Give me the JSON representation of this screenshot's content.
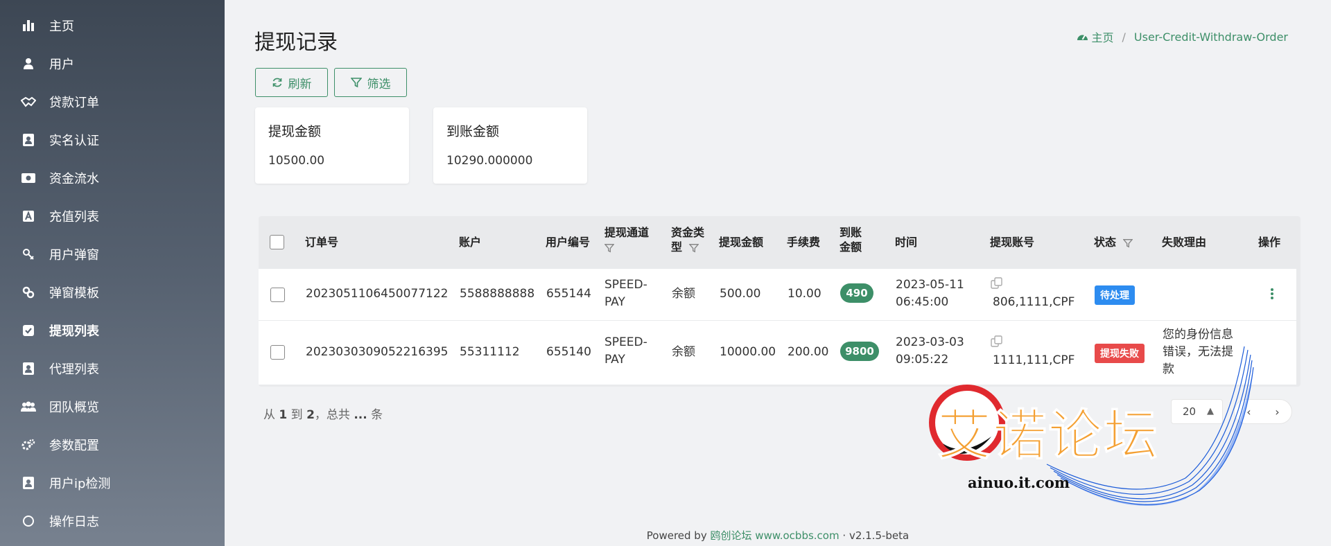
{
  "sidebar": {
    "items": [
      {
        "label": "主页",
        "icon": "bar-chart-icon"
      },
      {
        "label": "用户",
        "icon": "user-icon"
      },
      {
        "label": "贷款订单",
        "icon": "handshake-icon"
      },
      {
        "label": "实名认证",
        "icon": "id-card-icon"
      },
      {
        "label": "资金流水",
        "icon": "money-icon"
      },
      {
        "label": "充值列表",
        "icon": "recharge-icon"
      },
      {
        "label": "用户弹窗",
        "icon": "popup-icon"
      },
      {
        "label": "弹窗模板",
        "icon": "link-icon"
      },
      {
        "label": "提现列表",
        "icon": "check-square-icon",
        "active": true
      },
      {
        "label": "代理列表",
        "icon": "agent-icon"
      },
      {
        "label": "团队概览",
        "icon": "team-icon"
      },
      {
        "label": "参数配置",
        "icon": "cogs-icon"
      },
      {
        "label": "用户ip检测",
        "icon": "ip-check-icon"
      },
      {
        "label": "操作日志",
        "icon": "circle-icon"
      }
    ]
  },
  "header": {
    "title": "提现记录",
    "breadcrumb": {
      "home": "主页",
      "separator": "/",
      "current": "User-Credit-Withdraw-Order"
    }
  },
  "toolbar": {
    "refresh_label": "刷新",
    "filter_label": "筛选"
  },
  "stats": [
    {
      "title": "提现金额",
      "value": "10500.00"
    },
    {
      "title": "到账金额",
      "value": "10290.000000"
    }
  ],
  "table": {
    "columns": {
      "order_no": "订单号",
      "account": "账户",
      "user_id": "用户编号",
      "channel": "提现通道",
      "fund_type": "资金类型",
      "amount": "提现金额",
      "fee": "手续费",
      "received": "到账金额",
      "time": "时间",
      "withdraw_account": "提现账号",
      "status": "状态",
      "fail_reason": "失败理由",
      "actions": "操作"
    },
    "rows": [
      {
        "order_no": "2023051106450077122",
        "account": "5588888888",
        "user_id": "655144",
        "channel": "SPEED-PAY",
        "fund_type": "余额",
        "amount": "500.00",
        "fee": "10.00",
        "received": "490",
        "time": "2023-05-11 06:45:00",
        "withdraw_account": "806,1111,CPF",
        "status": "待处理",
        "status_color": "#2d8cf0",
        "fail_reason": ""
      },
      {
        "order_no": "2023030309052216395",
        "account": "55311112",
        "user_id": "655140",
        "channel": "SPEED-PAY",
        "fund_type": "余额",
        "amount": "10000.00",
        "fee": "200.00",
        "received": "9800",
        "time": "2023-03-03 09:05:22",
        "withdraw_account": "1111,111,CPF",
        "status": "提现失败",
        "status_color": "#e84a4a",
        "fail_reason": "您的身份信息错误，无法提款"
      }
    ]
  },
  "pagination": {
    "prefix": "从",
    "from": "1",
    "to_word": "到",
    "to": "2",
    "total_word": "，总共",
    "total": "...",
    "suffix": "条",
    "page_size": "20",
    "prev": "‹",
    "next": "›"
  },
  "footer": {
    "powered_by": "Powered by",
    "brand": "鸥创论坛",
    "url": "www.ocbbs.com",
    "dot": "·",
    "version": "v2.1.5-beta"
  },
  "watermark": {
    "title": "艾诺论坛",
    "subtitle": "ainuo.it.com"
  },
  "colors": {
    "accent": "#3d8f68",
    "pending": "#2d8cf0",
    "failed": "#e84a4a"
  }
}
